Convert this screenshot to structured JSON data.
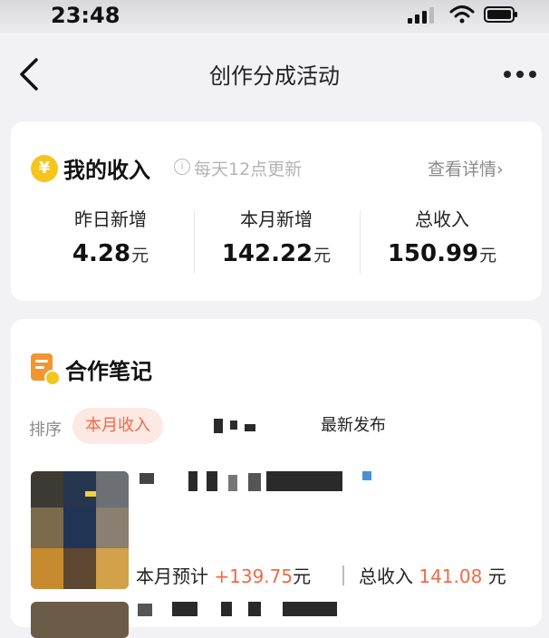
{
  "status_bar": {
    "time": "23:48"
  },
  "nav": {
    "title": "创作分成活动"
  },
  "income": {
    "title": "我的收入",
    "coin_symbol": "¥",
    "update_note": "每天12点更新",
    "detail_link": "查看详情",
    "stats": [
      {
        "label": "昨日新增",
        "value": "4.28",
        "unit": "元"
      },
      {
        "label": "本月新增",
        "value": "142.22",
        "unit": "元"
      },
      {
        "label": "总收入",
        "value": "150.99",
        "unit": "元"
      }
    ]
  },
  "notes": {
    "title": "合作笔记",
    "sort_label": "排序",
    "sort_tabs": [
      {
        "label": "本月收入",
        "active": true
      },
      {
        "label": "",
        "active": false
      },
      {
        "label": "最新发布",
        "active": false
      }
    ],
    "items": [
      {
        "month_est_label": "本月预计",
        "month_est_value": "+139.75",
        "month_est_unit": "元",
        "total_label": "总收入",
        "total_value": "141.08",
        "total_unit": "元"
      }
    ]
  },
  "colors": {
    "accent": "#f26a45",
    "coin": "#f5c51d",
    "card": "#ffffff",
    "background": "#f2f2f4"
  },
  "icons": [
    "back-arrow-icon",
    "more-icon",
    "yuan-coin-icon",
    "info-icon",
    "chevron-right-icon",
    "notes-icon",
    "signal-icon",
    "wifi-icon",
    "battery-icon"
  ]
}
